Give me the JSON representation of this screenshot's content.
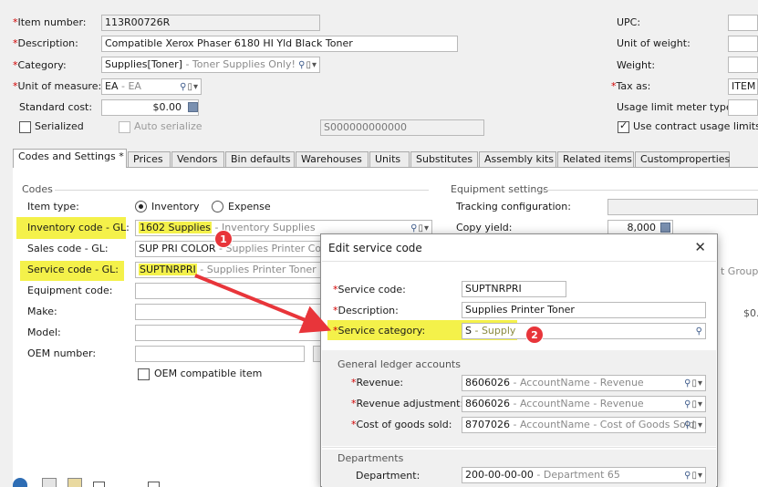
{
  "header": {
    "item_number_label": "Item number:",
    "item_number_value": "113R00726R",
    "description_label": "Description:",
    "description_value": "Compatible Xerox Phaser 6180 HI Yld Black Toner",
    "category_label": "Category:",
    "category_value": "Supplies[Toner]",
    "category_sub": " - Toner Supplies Only!",
    "uom_label": "Unit of measure:",
    "uom_value": "EA",
    "uom_sub": " - EA",
    "standard_cost_label": "Standard cost:",
    "standard_cost_value": "$0.00",
    "serialized_label": "Serialized",
    "auto_serialize_label": "Auto serialize",
    "serial_value": "S000000000000",
    "upc_label": "UPC:",
    "unit_weight_label": "Unit of weight:",
    "weight_label": "Weight:",
    "tax_as_label": "Tax as:",
    "tax_as_value": "ITEM -",
    "usage_limit_label": "Usage limit meter type:",
    "contract_usage_label": "Use contract usage limits fo"
  },
  "tabs": [
    {
      "label": "Codes and Settings",
      "mark": "*"
    },
    {
      "label": "Prices"
    },
    {
      "label": "Vendors"
    },
    {
      "label": "Bin defaults"
    },
    {
      "label": "Warehouses"
    },
    {
      "label": "Units"
    },
    {
      "label": "Substitutes"
    },
    {
      "label": "Assembly kits"
    },
    {
      "label": "Related items"
    },
    {
      "label": "Customproperties"
    }
  ],
  "codes": {
    "section_label": "Codes",
    "item_type_label": "Item type:",
    "inventory_label": "Inventory",
    "expense_label": "Expense",
    "inventory_code_label": "Inventory code - GL:",
    "inventory_code_value": "1602 Supplies",
    "inventory_code_sub": " - Inventory Supplies",
    "sales_code_label": "Sales code - GL:",
    "sales_code_value": "SUP PRI COLOR",
    "sales_code_sub": " - Supplies Printer Color",
    "service_code_label": "Service code - GL:",
    "service_code_value": "SUPTNRPRI",
    "service_code_sub": " - Supplies Printer Toner",
    "equipment_code_label": "Equipment code:",
    "make_label": "Make:",
    "model_label": "Model:",
    "oem_number_label": "OEM number:",
    "oem_compatible_label": "OEM compatible item"
  },
  "equipment": {
    "section_label": "Equipment settings",
    "tracking_label": "Tracking configuration:",
    "copy_yield_label": "Copy yield:",
    "copy_yield_value": "8,000",
    "group_fragment": "t Group",
    "price_fragment": "$0."
  },
  "dialog": {
    "title": "Edit service code",
    "service_code_label": "Service code:",
    "service_code_value": "SUPTNRPRI",
    "description_label": "Description:",
    "description_value": "Supplies Printer Toner",
    "service_category_label": "Service category:",
    "service_category_value": "S",
    "service_category_sub": " - Supply",
    "gl_section_label": "General ledger accounts",
    "revenue_label": "Revenue:",
    "revenue_value": "8606026",
    "revenue_sub": " - AccountName - Revenue",
    "revenue_adj_label": "Revenue adjustment:",
    "revenue_adj_value": "8606026",
    "revenue_adj_sub": " - AccountName - Revenue",
    "cogs_label": "Cost of goods sold:",
    "cogs_value": "8707026",
    "cogs_sub": " - AccountName - Cost of Goods Sold",
    "departments_section_label": "Departments",
    "department_label": "Department:",
    "department_value": "200-00-00-00",
    "department_sub": " - Department 65"
  },
  "callouts": {
    "one": "1",
    "two": "2"
  },
  "colors": {
    "highlight": "#f4f14a",
    "arrow": "#e8353a",
    "required": "#d10000"
  }
}
